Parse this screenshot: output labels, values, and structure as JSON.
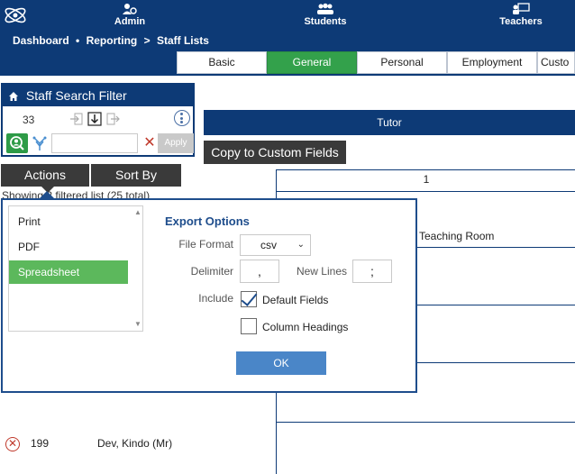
{
  "nav": {
    "items": [
      {
        "label": "Admin",
        "icon": "admin-gear-user-icon"
      },
      {
        "label": "Students",
        "icon": "students-group-icon"
      },
      {
        "label": "Teachers",
        "icon": "teachers-board-icon"
      }
    ]
  },
  "breadcrumb": {
    "items": [
      "Dashboard",
      "Reporting",
      "Staff Lists"
    ],
    "sep1": "•",
    "sep2": ">"
  },
  "tabs": [
    {
      "label": "Basic",
      "active": false
    },
    {
      "label": "General",
      "active": true
    },
    {
      "label": "Personal",
      "active": false
    },
    {
      "label": "Employment",
      "active": false
    },
    {
      "label": "Custo",
      "active": false
    }
  ],
  "filter": {
    "title": "Staff Search Filter",
    "count": "33",
    "apply_label": "Apply",
    "input_value": ""
  },
  "actions": {
    "actions_label": "Actions",
    "sort_label": "Sort By",
    "showing_text": "Showing 2 filtered list (25 total)"
  },
  "table": {
    "tutor_header": "Tutor",
    "copy_button": "Copy to Custom Fields",
    "column_1": "1",
    "teaching_room": "Teaching Room",
    "row": {
      "id": "199",
      "name": "Dev, Kindo (Mr)"
    }
  },
  "export": {
    "list_items": [
      "Print",
      "PDF",
      "Spreadsheet"
    ],
    "selected": "Spreadsheet",
    "title": "Export Options",
    "file_format_label": "File Format",
    "file_format_value": "csv",
    "delimiter_label": "Delimiter",
    "delimiter_value": ",",
    "new_lines_label": "New Lines",
    "new_lines_value": ";",
    "include_label": "Include",
    "default_fields_label": "Default Fields",
    "default_fields_checked": true,
    "column_headings_label": "Column Headings",
    "column_headings_checked": false,
    "ok_label": "OK"
  },
  "colors": {
    "navy": "#0d3a76",
    "green": "#33a14b",
    "dark": "#3a3a3a",
    "ok_blue": "#4a86c8",
    "danger": "#c0392b"
  }
}
